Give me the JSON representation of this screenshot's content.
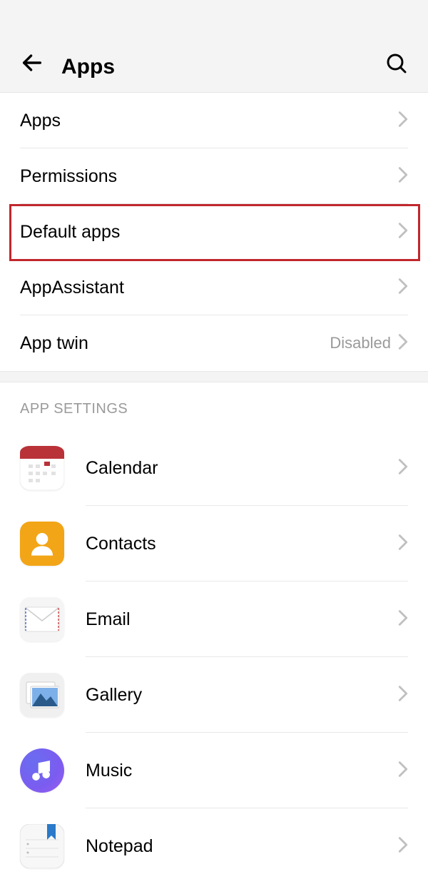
{
  "header": {
    "title": "Apps"
  },
  "rows": {
    "apps": "Apps",
    "permissions": "Permissions",
    "default_apps": "Default apps",
    "app_assistant": "AppAssistant",
    "app_twin": "App twin",
    "app_twin_value": "Disabled"
  },
  "section_header": "APP SETTINGS",
  "apps": {
    "calendar": "Calendar",
    "contacts": "Contacts",
    "email": "Email",
    "gallery": "Gallery",
    "music": "Music",
    "notepad": "Notepad"
  }
}
